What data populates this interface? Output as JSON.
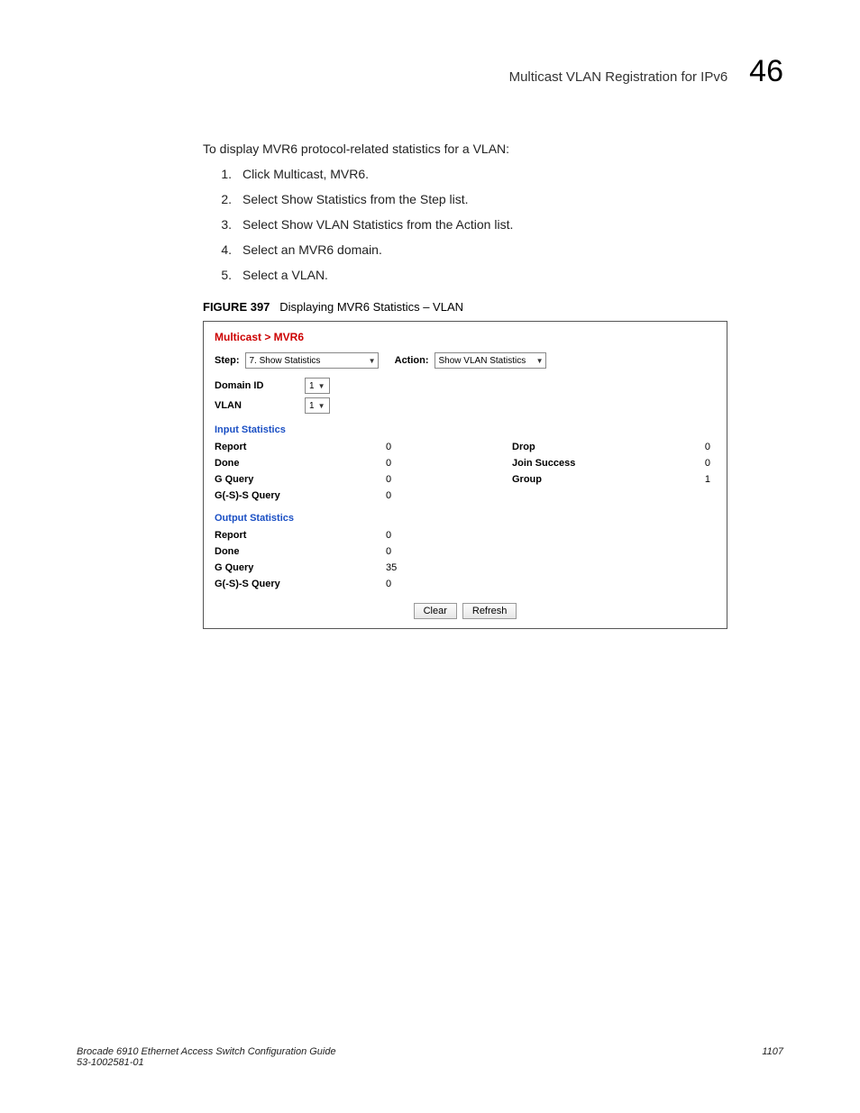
{
  "header": {
    "title": "Multicast VLAN Registration for IPv6",
    "chapter": "46"
  },
  "intro": "To display MVR6 protocol-related statistics for a VLAN:",
  "steps": [
    "Click Multicast, MVR6.",
    "Select Show Statistics from the Step list.",
    "Select Show VLAN Statistics from the Action list.",
    "Select an MVR6 domain.",
    "Select a VLAN."
  ],
  "figure": {
    "label": "FIGURE 397",
    "caption": "Displaying MVR6 Statistics – VLAN"
  },
  "panel": {
    "breadcrumb": "Multicast > MVR6",
    "step_label": "Step:",
    "step_value": "7. Show Statistics",
    "action_label": "Action:",
    "action_value": "Show VLAN Statistics",
    "domain_label": "Domain ID",
    "domain_value": "1",
    "vlan_label": "VLAN",
    "vlan_value": "1",
    "input_title": "Input Statistics",
    "input": [
      {
        "l": "Report",
        "v": "0",
        "r": "Drop",
        "rv": "0"
      },
      {
        "l": "Done",
        "v": "0",
        "r": "Join Success",
        "rv": "0"
      },
      {
        "l": "G Query",
        "v": "0",
        "r": "Group",
        "rv": "1"
      },
      {
        "l": "G(-S)-S Query",
        "v": "0",
        "r": "",
        "rv": ""
      }
    ],
    "output_title": "Output Statistics",
    "output": [
      {
        "l": "Report",
        "v": "0"
      },
      {
        "l": "Done",
        "v": "0"
      },
      {
        "l": "G Query",
        "v": "35"
      },
      {
        "l": "G(-S)-S Query",
        "v": "0"
      }
    ],
    "clear": "Clear",
    "refresh": "Refresh"
  },
  "footer": {
    "book": "Brocade 6910 Ethernet Access Switch Configuration Guide",
    "doc": "53-1002581-01",
    "page": "1107"
  }
}
